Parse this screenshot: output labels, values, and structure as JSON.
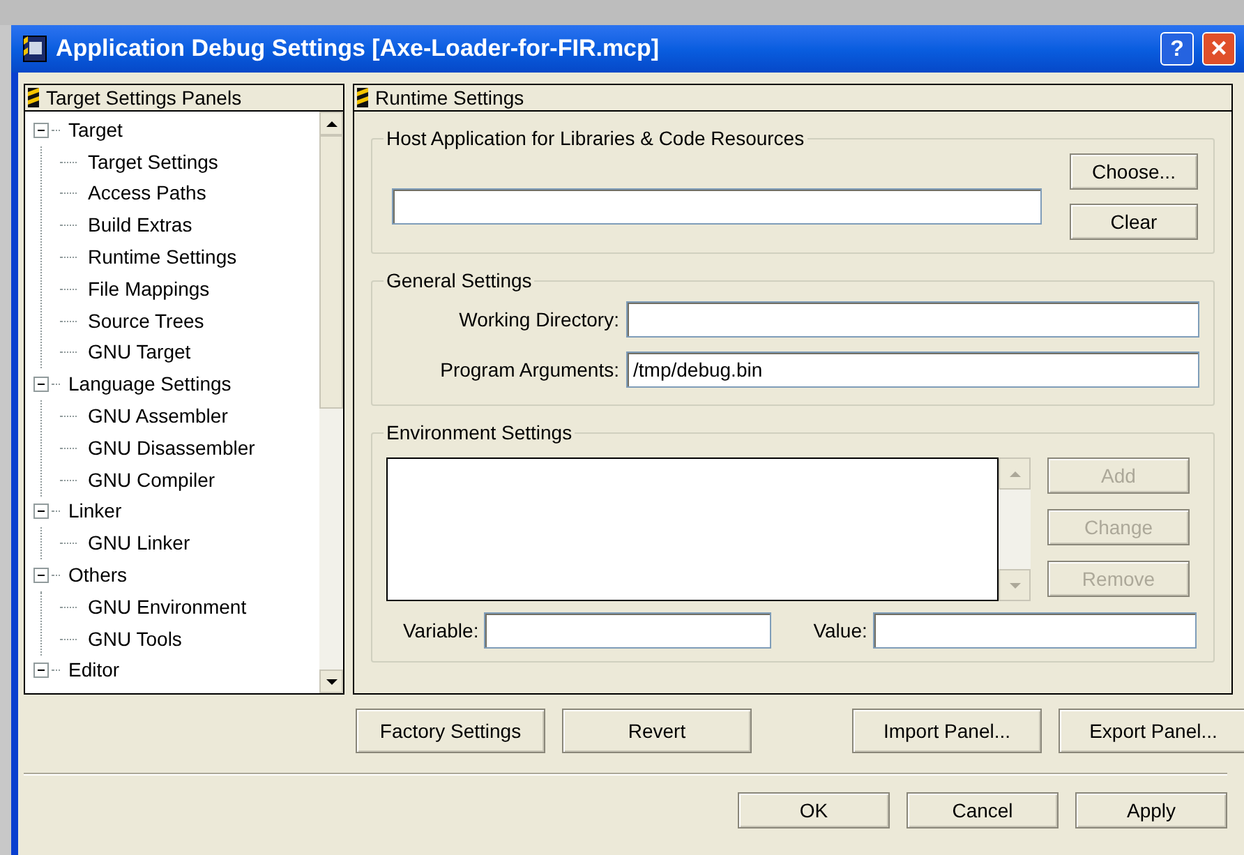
{
  "window": {
    "title": "Application Debug Settings [Axe-Loader-for-FIR.mcp]",
    "help": "?",
    "close": "×"
  },
  "left_panel": {
    "title": "Target Settings Panels",
    "tree": [
      {
        "label": "Target",
        "expanded": true,
        "children": [
          {
            "label": "Target Settings"
          },
          {
            "label": "Access Paths"
          },
          {
            "label": "Build Extras"
          },
          {
            "label": "Runtime Settings"
          },
          {
            "label": "File Mappings"
          },
          {
            "label": "Source Trees"
          },
          {
            "label": "GNU Target"
          }
        ]
      },
      {
        "label": "Language Settings",
        "expanded": true,
        "children": [
          {
            "label": "GNU Assembler"
          },
          {
            "label": "GNU Disassembler"
          },
          {
            "label": "GNU Compiler"
          }
        ]
      },
      {
        "label": "Linker",
        "expanded": true,
        "children": [
          {
            "label": "GNU Linker"
          }
        ]
      },
      {
        "label": "Others",
        "expanded": true,
        "children": [
          {
            "label": "GNU Environment"
          },
          {
            "label": "GNU Tools"
          }
        ]
      },
      {
        "label": "Editor",
        "expanded": true
      }
    ]
  },
  "right_panel": {
    "title": "Runtime Settings",
    "host_group": {
      "title": "Host Application for Libraries & Code Resources",
      "buttons": [
        {
          "label": "Choose...",
          "disabled": false
        },
        {
          "label": "Clear",
          "disabled": false
        }
      ]
    },
    "general_group": {
      "title": "General Settings",
      "fields": [
        {
          "label": "Working Directory:"
        },
        {
          "label": "Program Arguments:",
          "value": "/tmp/debug.bin"
        }
      ]
    },
    "env_group": {
      "title": "Environment Settings",
      "buttons": [
        {
          "label": "Add",
          "disabled": true
        },
        {
          "label": "Change",
          "disabled": true
        },
        {
          "label": "Remove",
          "disabled": true
        }
      ],
      "variable": {
        "label": "Variable:"
      },
      "value": {
        "label": "Value:"
      }
    }
  },
  "panel_buttons": [
    "Factory Settings",
    "Revert",
    "Import Panel...",
    "Export Panel..."
  ],
  "dialog_buttons": [
    "OK",
    "Cancel",
    "Apply"
  ]
}
